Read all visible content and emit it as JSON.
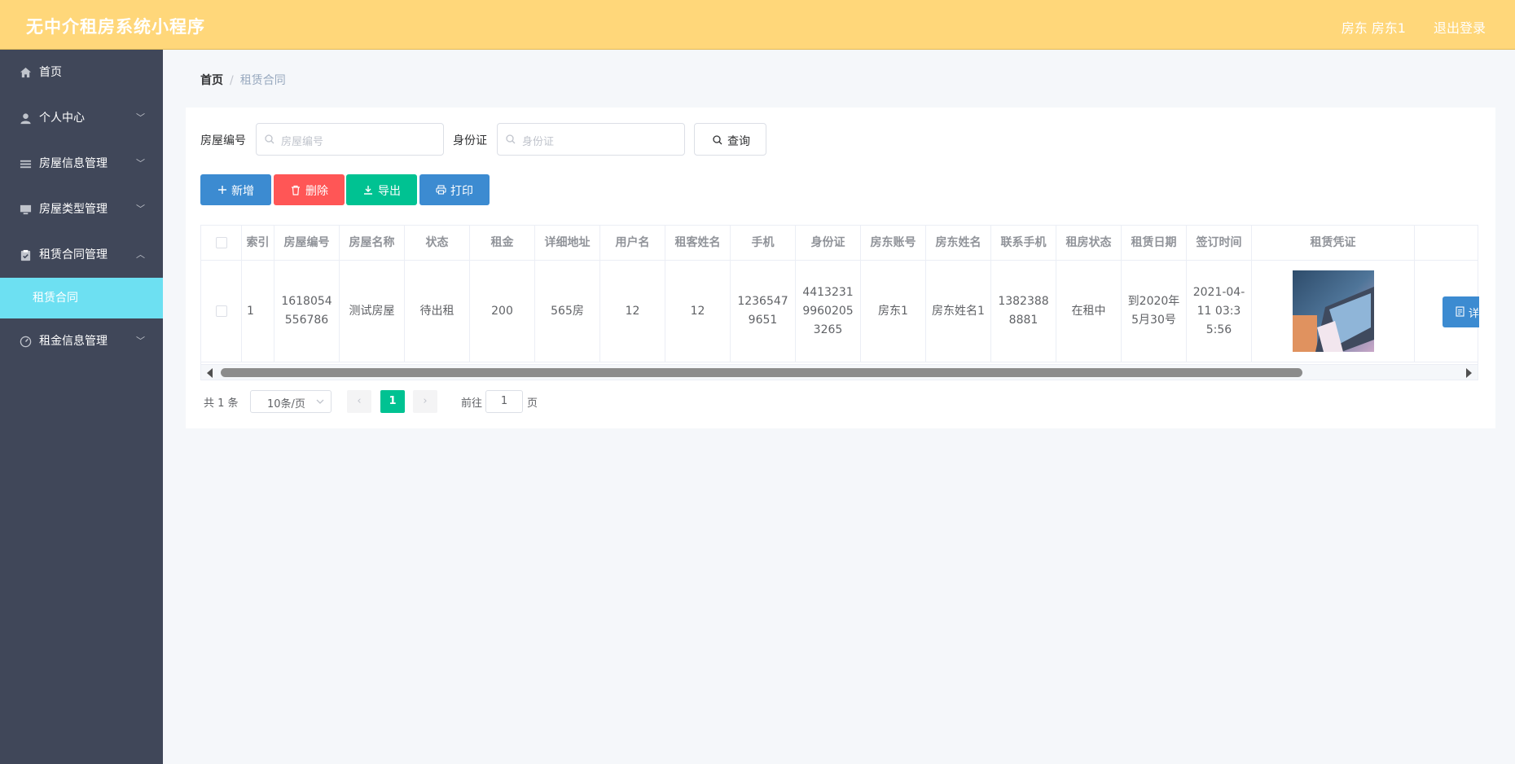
{
  "app": {
    "title": "无中介租房系统小程序",
    "user": "房东 房东1",
    "logout": "退出登录"
  },
  "sidebar": {
    "items": [
      {
        "label": "首页",
        "icon": "home-icon"
      },
      {
        "label": "个人中心",
        "icon": "user-icon"
      },
      {
        "label": "房屋信息管理",
        "icon": "list-icon"
      },
      {
        "label": "房屋类型管理",
        "icon": "monitor-icon"
      },
      {
        "label": "租赁合同管理",
        "icon": "clipboard-icon"
      },
      {
        "label": "租金信息管理",
        "icon": "gauge-icon"
      }
    ],
    "sub_active": "租赁合同"
  },
  "breadcrumb": {
    "home": "首页",
    "sep": "/",
    "current": "租赁合同"
  },
  "filters": {
    "house_no_label": "房屋编号",
    "house_no_placeholder": "房屋编号",
    "id_label": "身份证",
    "id_placeholder": "身份证",
    "query_label": "查询"
  },
  "actions": {
    "add": "新增",
    "delete": "删除",
    "export": "导出",
    "print": "打印"
  },
  "table": {
    "columns": [
      "索引",
      "房屋编号",
      "房屋名称",
      "状态",
      "租金",
      "详细地址",
      "用户名",
      "租客姓名",
      "手机",
      "身份证",
      "房东账号",
      "房东姓名",
      "联系手机",
      "租房状态",
      "租赁日期",
      "签订时间",
      "租赁凭证"
    ],
    "rows": [
      {
        "index": "1",
        "house_no": "1618054556786",
        "house_name": "测试房屋",
        "status": "待出租",
        "rent": "200",
        "address": "565房",
        "username": "12",
        "tenant": "12",
        "phone": "12365479651",
        "id_card": "441323199602053265",
        "landlord_account": "房东1",
        "landlord_name": "房东姓名1",
        "contact_phone": "13823888881",
        "rent_status": "在租中",
        "lease_date": "到2020年5月30号",
        "sign_time": "2021-04-11 03:35:56",
        "detail_label": "详"
      }
    ]
  },
  "pagination": {
    "total": "共 1 条",
    "page_size": "10条/页",
    "prev": "‹",
    "current": "1",
    "next": "›",
    "goto_label": "前往",
    "goto_value": "1",
    "page_suffix": "页"
  },
  "colors": {
    "header": "#ffd77a",
    "sidebar": "#404759",
    "sidebar_active": "#6de0f2",
    "btn_add": "#3c8bd1",
    "btn_delete": "#ff5656",
    "btn_export": "#00c292",
    "btn_print": "#3c8bd1"
  }
}
